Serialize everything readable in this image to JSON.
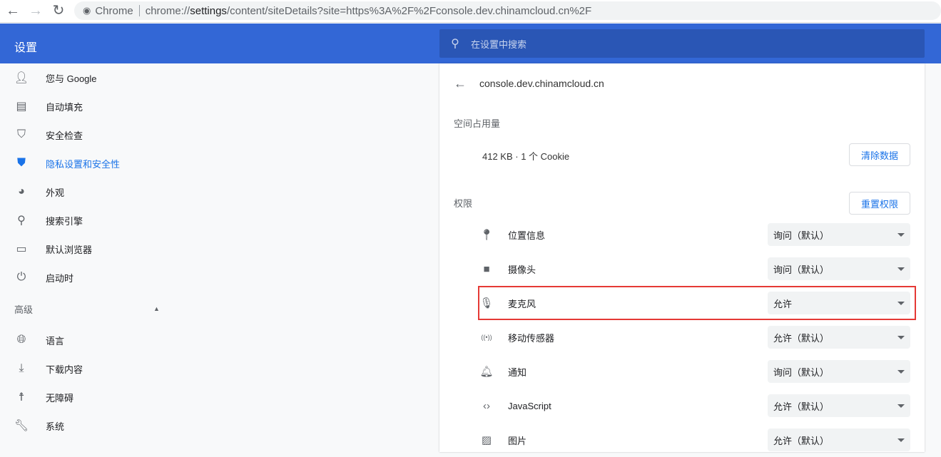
{
  "browser": {
    "omnibox_label": "Chrome",
    "url_prefix": "chrome://",
    "url_host": "settings",
    "url_path": "/content/siteDetails?site=https%3A%2F%2Fconsole.dev.chinamcloud.cn%2F"
  },
  "header": {
    "title": "设置",
    "search_placeholder": "在设置中搜索"
  },
  "sidebar": {
    "items": [
      {
        "label": "您与 Google",
        "icon": "person-icon"
      },
      {
        "label": "自动填充",
        "icon": "clipboard-icon"
      },
      {
        "label": "安全检查",
        "icon": "shield-check-icon"
      },
      {
        "label": "隐私设置和安全性",
        "icon": "shield-icon",
        "active": true
      },
      {
        "label": "外观",
        "icon": "palette-icon"
      },
      {
        "label": "搜索引擎",
        "icon": "search-icon"
      },
      {
        "label": "默认浏览器",
        "icon": "browser-icon"
      },
      {
        "label": "启动时",
        "icon": "power-icon"
      }
    ],
    "advanced": "高级",
    "advanced_items": [
      {
        "label": "语言",
        "icon": "globe-icon"
      },
      {
        "label": "下载内容",
        "icon": "download-icon"
      },
      {
        "label": "无障碍",
        "icon": "accessibility-icon"
      },
      {
        "label": "系统",
        "icon": "wrench-icon"
      }
    ]
  },
  "main": {
    "site": "console.dev.chinamcloud.cn",
    "usage_heading": "空间占用量",
    "usage": "412 KB · 1 个 Cookie",
    "clear_button": "清除数据",
    "permissions_heading": "权限",
    "reset_button": "重置权限",
    "permissions": [
      {
        "label": "位置信息",
        "value": "询问（默认）",
        "icon": "location-icon"
      },
      {
        "label": "摄像头",
        "value": "询问（默认）",
        "icon": "camera-icon"
      },
      {
        "label": "麦克风",
        "value": "允许",
        "icon": "microphone-icon"
      },
      {
        "label": "移动传感器",
        "value": "允许（默认）",
        "icon": "sensors-icon"
      },
      {
        "label": "通知",
        "value": "询问（默认）",
        "icon": "bell-icon"
      },
      {
        "label": "JavaScript",
        "value": "允许（默认）",
        "icon": "code-icon"
      },
      {
        "label": "图片",
        "value": "允许（默认）",
        "icon": "image-icon"
      }
    ]
  },
  "colors": {
    "header": "#3367d6",
    "accent": "#1a73e8",
    "highlight": "#e53935"
  }
}
